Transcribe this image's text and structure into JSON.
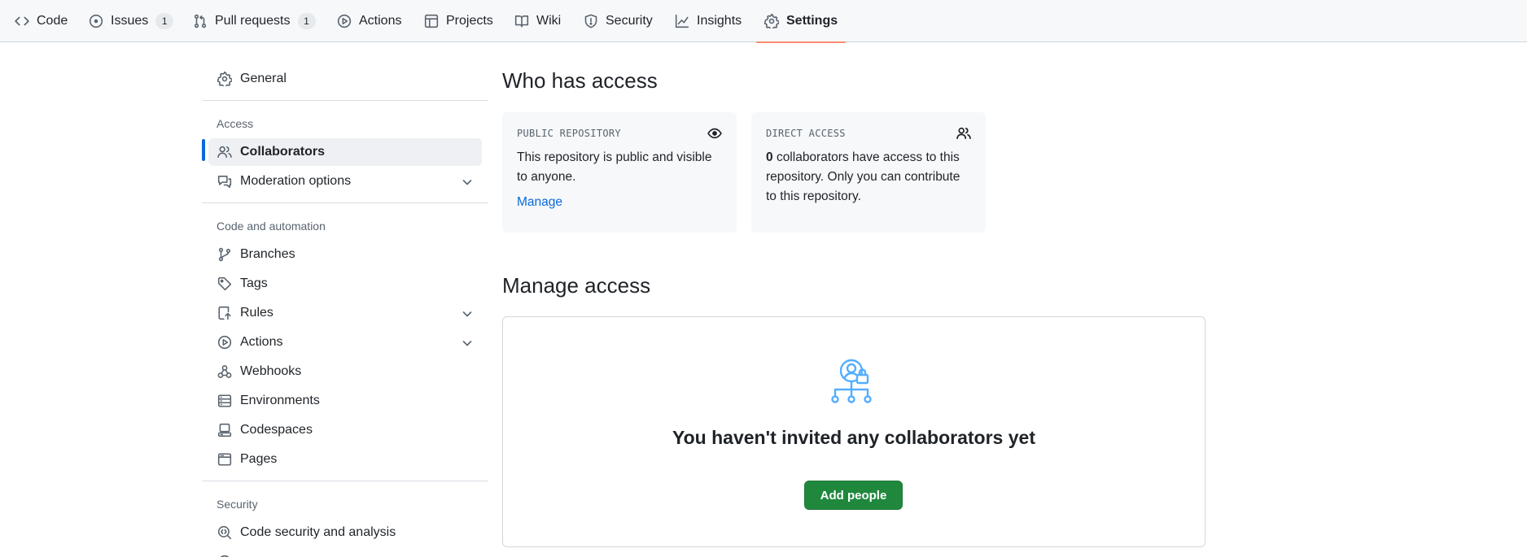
{
  "nav": {
    "tabs": [
      {
        "label": "Code",
        "icon": "code-icon"
      },
      {
        "label": "Issues",
        "icon": "issue-opened-icon",
        "count": "1"
      },
      {
        "label": "Pull requests",
        "icon": "git-pull-request-icon",
        "count": "1"
      },
      {
        "label": "Actions",
        "icon": "play-icon"
      },
      {
        "label": "Projects",
        "icon": "table-icon"
      },
      {
        "label": "Wiki",
        "icon": "book-icon"
      },
      {
        "label": "Security",
        "icon": "shield-icon"
      },
      {
        "label": "Insights",
        "icon": "graph-icon"
      },
      {
        "label": "Settings",
        "icon": "gear-icon",
        "selected": true
      }
    ],
    "selected_underline_color": "#fd8c73"
  },
  "sidebar": {
    "general": "General",
    "access_heading": "Access",
    "collaborators": "Collaborators",
    "moderation": "Moderation options",
    "code_heading": "Code and automation",
    "branches": "Branches",
    "tags": "Tags",
    "rules": "Rules",
    "actions": "Actions",
    "webhooks": "Webhooks",
    "environments": "Environments",
    "codespaces": "Codespaces",
    "pages": "Pages",
    "security_heading": "Security",
    "code_security": "Code security and analysis"
  },
  "main": {
    "who_title": "Who has access",
    "public_card": {
      "heading": "PUBLIC REPOSITORY",
      "body": "This repository is public and visible to anyone.",
      "link": "Manage"
    },
    "direct_card": {
      "heading": "DIRECT ACCESS",
      "count": "0",
      "body": "collaborators have access to this repository. Only you can contribute to this repository."
    },
    "manage_title": "Manage access",
    "blank_title": "You haven't invited any collaborators yet",
    "add_button": "Add people"
  },
  "colors": {
    "accent": "#0969da",
    "primary_button": "#1f883d",
    "illustration": "#54aeff"
  }
}
